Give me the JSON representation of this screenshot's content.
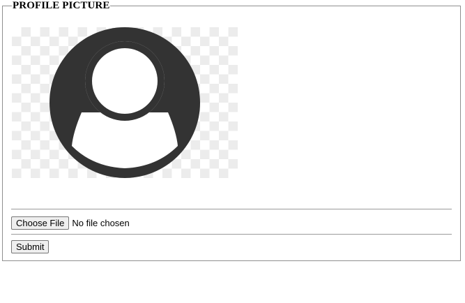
{
  "form": {
    "legend": "PROFILE PICTURE",
    "avatar": {
      "icon": "user-avatar-icon",
      "icon_color": "#333333",
      "checker_colors": [
        "#ffffff",
        "#ececec"
      ]
    },
    "file_input": {
      "button_label": "Choose File",
      "status": "No file chosen"
    },
    "submit_label": "Submit"
  }
}
